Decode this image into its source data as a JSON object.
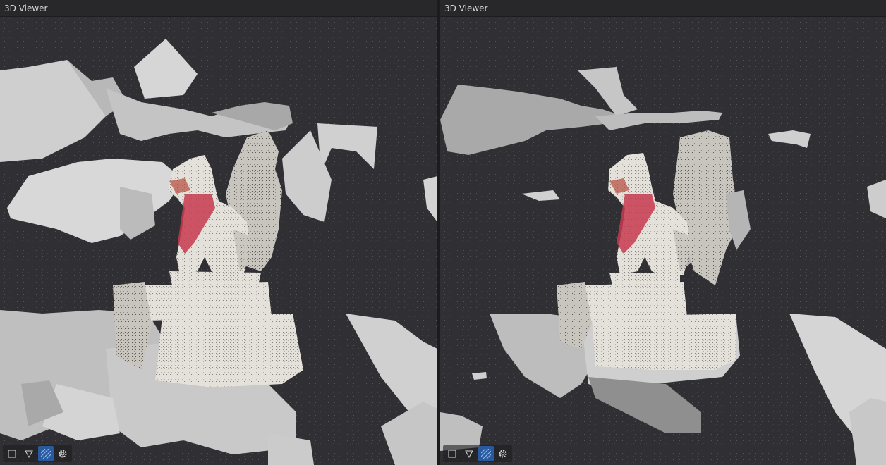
{
  "panes": [
    {
      "title": "3D Viewer",
      "toolbar": {
        "buttons": [
          "box-outline-icon",
          "triangle-down-icon",
          "hatch-grid-icon",
          "gear-icon"
        ],
        "active": "hatch-grid-icon"
      }
    },
    {
      "title": "3D Viewer",
      "toolbar": {
        "buttons": [
          "box-outline-icon",
          "triangle-down-icon",
          "hatch-grid-icon",
          "gear-icon"
        ],
        "active": "hatch-grid-icon"
      }
    }
  ],
  "colors": {
    "viewport_bg": "#303034",
    "mesh_light": "#d9d9d9",
    "mesh_mid": "#b8b8b8",
    "mesh_dark": "#8d8d8d",
    "statue": "#e6e2dc",
    "bib": "#c73a4f",
    "accent_active": "#2a5a9e"
  }
}
